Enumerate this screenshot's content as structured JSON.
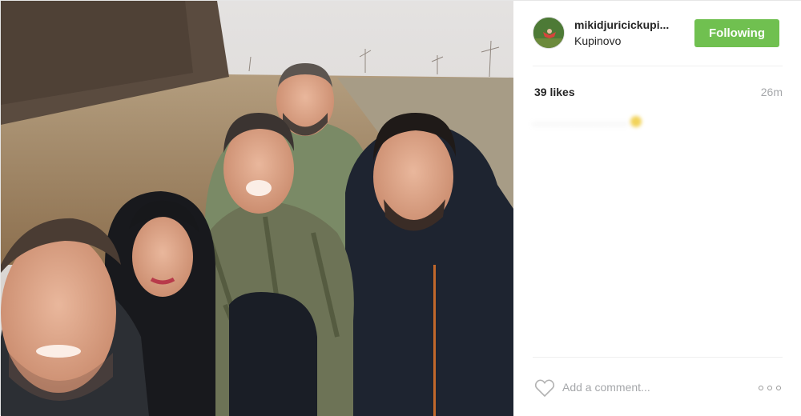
{
  "post": {
    "username": "mikidjuricickupi...",
    "location": "Kupinovo",
    "follow_label": "Following",
    "likes": "39 likes",
    "time_ago": "26m",
    "comment_placeholder": "Add a comment..."
  },
  "icons": {
    "like": "heart-icon",
    "more": "more-options-icon"
  },
  "colors": {
    "follow_button": "#70c050",
    "muted_text": "#a5a7aa",
    "divider": "#efefef"
  }
}
